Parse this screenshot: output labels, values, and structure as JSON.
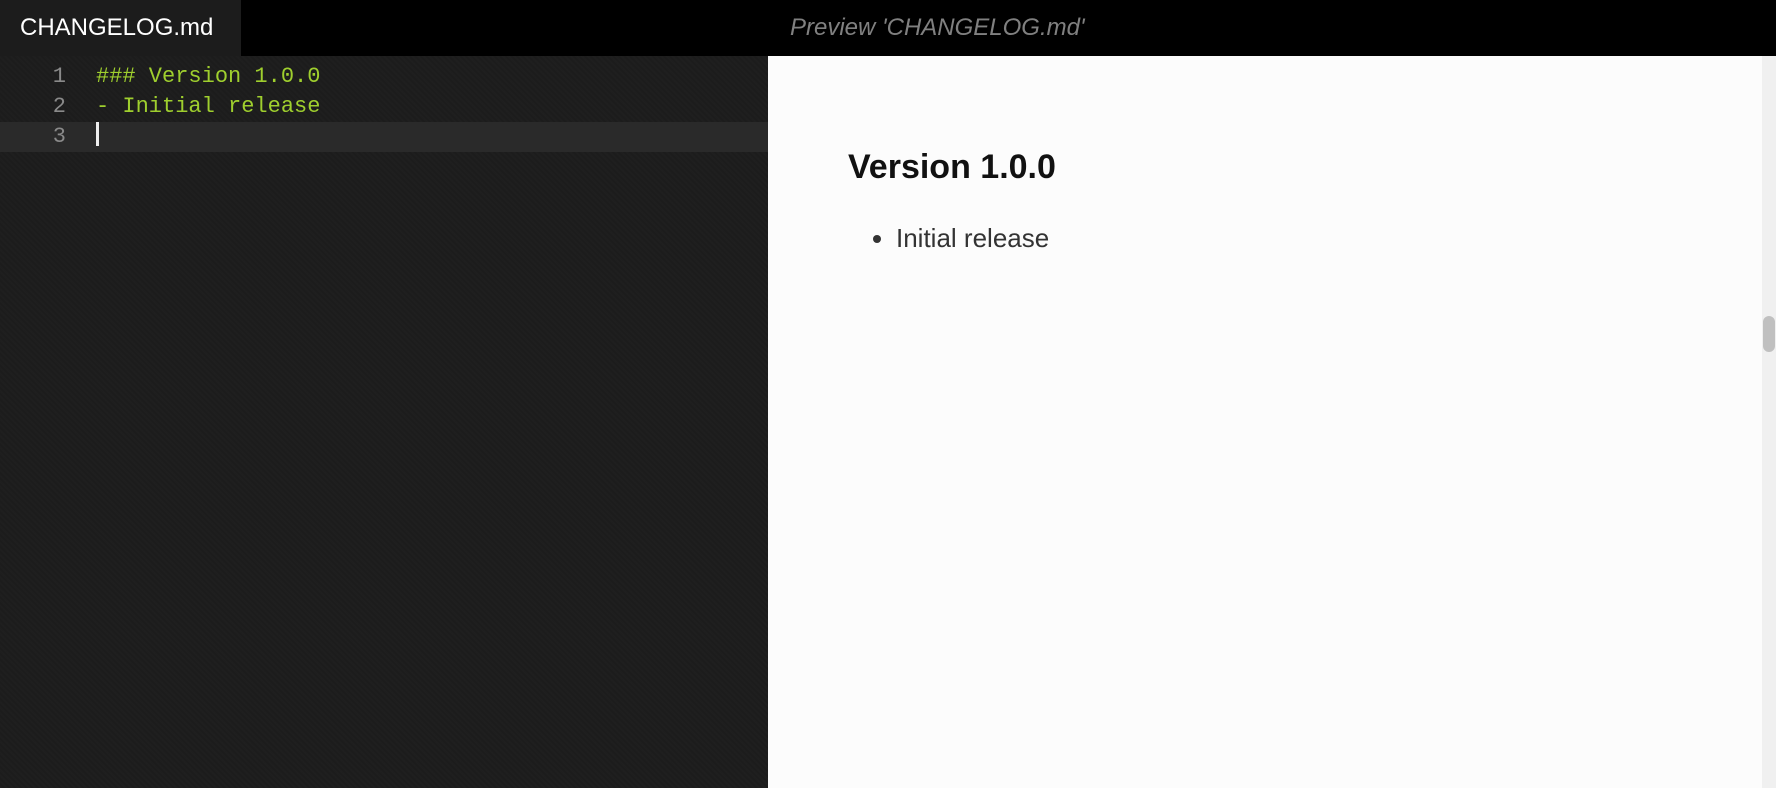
{
  "editor": {
    "tab_title": "CHANGELOG.md",
    "lines": [
      {
        "num": "1",
        "text": "### Version 1.0.0",
        "cls": "tok-heading",
        "current": false
      },
      {
        "num": "2",
        "text": "- Initial release",
        "cls": "tok-list",
        "current": false
      },
      {
        "num": "3",
        "text": "",
        "cls": "",
        "current": true
      }
    ]
  },
  "preview": {
    "tab_title": "Preview 'CHANGELOG.md'",
    "heading": "Version 1.0.0",
    "bullets": [
      "Initial release"
    ]
  }
}
